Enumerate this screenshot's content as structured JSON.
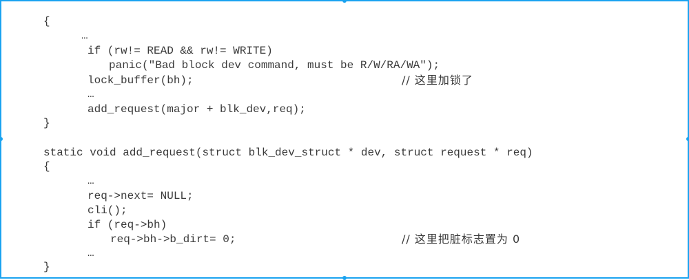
{
  "code": {
    "block1": {
      "open_brace": "{",
      "ellipsis1": "…",
      "if_line": "if (rw!= READ && rw!= WRITE)",
      "panic_line": "panic(\"Bad block dev command, must be R/W/RA/WA\");",
      "lock_line": "lock_buffer(bh);",
      "lock_comment": "// 这里加锁了",
      "ellipsis2": "…",
      "add_request_call": "add_request(major + blk_dev,req);",
      "close_brace": "}"
    },
    "block2": {
      "signature": "static void add_request(struct blk_dev_struct * dev, struct request * req)",
      "open_brace": "{",
      "ellipsis1": "…",
      "next_line": "req->next= NULL;",
      "cli_line": "cli();",
      "if_line": "if (req->bh)",
      "dirt_line": "req->bh->b_dirt= 0;",
      "dirt_comment": "// 这里把脏标志置为 0",
      "ellipsis2": "…",
      "close_brace": "}"
    }
  }
}
